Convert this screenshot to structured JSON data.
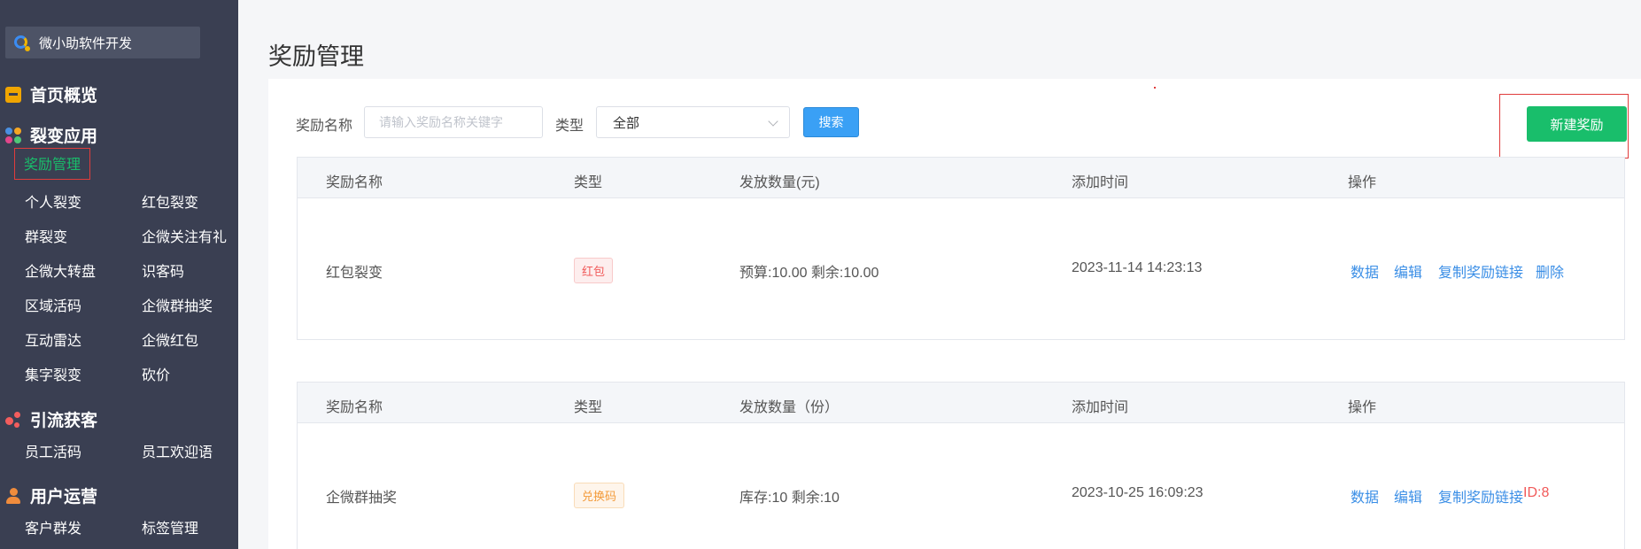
{
  "brand": {
    "name": "微小助软件开发",
    "icon": "brand-logo-icon"
  },
  "sidebar": {
    "groups": [
      {
        "label": "首页概览",
        "icon": "home-icon",
        "items": []
      },
      {
        "label": "裂变应用",
        "icon": "apps-grid-icon",
        "items": [
          "奖励管理",
          "个人裂变",
          "红包裂变",
          "群裂变",
          "企微关注有礼",
          "企微大转盘",
          "识客码",
          "区域活码",
          "企微群抽奖",
          "互动雷达",
          "企微红包",
          "集字裂变",
          "砍价"
        ]
      },
      {
        "label": "引流获客",
        "icon": "share-icon",
        "items": [
          "员工活码",
          "员工欢迎语"
        ]
      },
      {
        "label": "用户运营",
        "icon": "user-icon",
        "items": [
          "客户群发",
          "标签管理"
        ]
      }
    ],
    "active_item": "奖励管理"
  },
  "page": {
    "title": "奖励管理"
  },
  "filters": {
    "name_label": "奖励名称",
    "name_placeholder": "请输入奖励名称关键字",
    "type_label": "类型",
    "type_value": "全部",
    "search_label": "搜索",
    "new_label": "新建奖励"
  },
  "tables": [
    {
      "headers": [
        "奖励名称",
        "类型",
        "发放数量(元)",
        "添加时间",
        "操作"
      ],
      "row": {
        "name": "红包裂变",
        "type": "红包",
        "quantity": "预算:10.00 剩余:10.00",
        "time": "2023-11-14 14:23:13",
        "actions": [
          "数据",
          "编辑",
          "复制奖励链接",
          "删除"
        ]
      }
    },
    {
      "headers": [
        "奖励名称",
        "类型",
        "发放数量（份）",
        "添加时间",
        "操作"
      ],
      "row": {
        "name": "企微群抽奖",
        "type": "兑换码",
        "quantity": "库存:10 剩余:10",
        "time": "2023-10-25 16:09:23",
        "actions": [
          "数据",
          "编辑",
          "复制奖励链接"
        ],
        "id_text": "ID:8"
      }
    }
  ],
  "colors": {
    "sidebar_bg": "#3a3f52",
    "accent_green": "#19be6b",
    "link_blue": "#3a8ee6",
    "search_blue": "#3aa0f5",
    "highlight_red": "#e03c3c"
  }
}
